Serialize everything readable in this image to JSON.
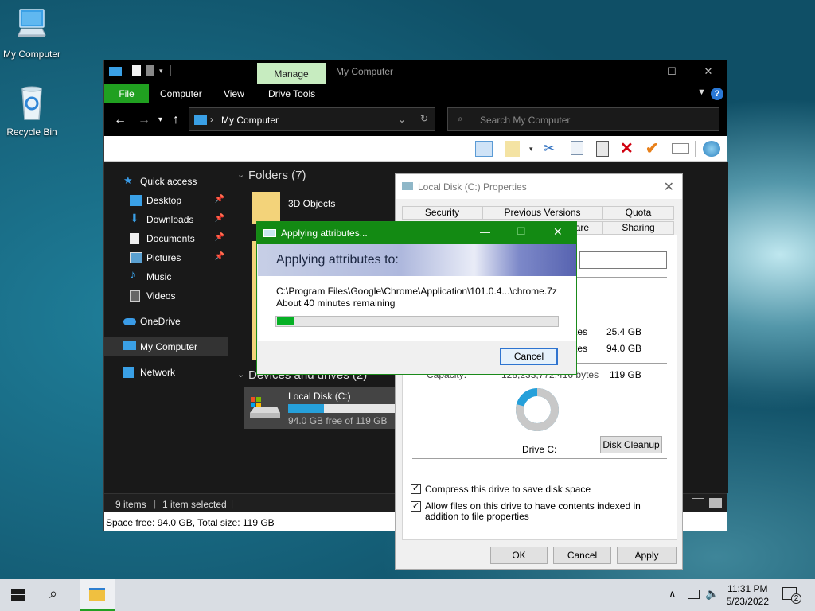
{
  "desktop": {
    "icons": [
      {
        "label": "My Computer"
      },
      {
        "label": "Recycle Bin"
      }
    ]
  },
  "explorer": {
    "manage_tab": "Manage",
    "title": "My Computer",
    "ribbon_tabs": [
      "File",
      "Computer",
      "View",
      "Drive Tools"
    ],
    "address": "My Computer",
    "search_placeholder": "Search My Computer",
    "nav": {
      "quick_access": "Quick access",
      "items": [
        {
          "label": "Desktop",
          "pinned": true
        },
        {
          "label": "Downloads",
          "pinned": true
        },
        {
          "label": "Documents",
          "pinned": true
        },
        {
          "label": "Pictures",
          "pinned": true
        },
        {
          "label": "Music",
          "pinned": false
        },
        {
          "label": "Videos",
          "pinned": false
        }
      ],
      "onedrive": "OneDrive",
      "my_computer": "My Computer",
      "network": "Network"
    },
    "content": {
      "folders_header": "Folders (7)",
      "first_folder": "3D Objects",
      "devices_header": "Devices and drives (2)",
      "drive": {
        "name": "Local Disk (C:)",
        "free_text": "94.0 GB free of 119 GB",
        "used_fraction": 0.21
      }
    },
    "status": {
      "items": "9 items",
      "selected": "1 item selected"
    },
    "info": "Space free: 94.0 GB, Total size: 119 GB"
  },
  "properties": {
    "title": "Local Disk (C:) Properties",
    "tabs_row1": [
      "Security",
      "Previous Versions",
      "Quota"
    ],
    "tabs_row2": [
      "are",
      "Sharing"
    ],
    "rows": [
      {
        "label": "tes",
        "size": "25.4 GB"
      },
      {
        "label": "tes",
        "size": "94.0 GB"
      }
    ],
    "capacity_label": "Capacity:",
    "capacity_bytes": "128,233,772,416 bytes",
    "capacity_size": "119 GB",
    "drive_label": "Drive C:",
    "disk_cleanup": "Disk Cleanup",
    "compress": "Compress this drive to save disk space",
    "compress_checked": true,
    "index": "Allow files on this drive to have contents indexed in addition to file properties",
    "index_checked": true,
    "buttons": {
      "ok": "OK",
      "cancel": "Cancel",
      "apply": "Apply"
    }
  },
  "applying": {
    "title": "Applying attributes...",
    "banner": "Applying attributes to:",
    "path": "C:\\Program Files\\Google\\Chrome\\Application\\101.0.4...\\chrome.7z",
    "remaining": "About 40 minutes remaining",
    "progress": 0.03,
    "cancel": "Cancel"
  },
  "taskbar": {
    "time": "11:31 PM",
    "date": "5/23/2022",
    "notifications": "2"
  },
  "colors": {
    "accent_green": "#138a13",
    "progress_green": "#06b025",
    "drive_bar": "#26a0da"
  }
}
